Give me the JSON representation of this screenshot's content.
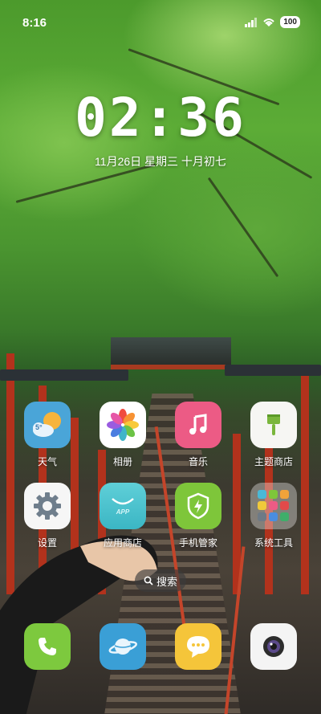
{
  "status_bar": {
    "time": "8:16",
    "battery": "100"
  },
  "lock": {
    "clock": "02:36",
    "date": "11月26日 星期三 十月初七"
  },
  "weather": {
    "temp": "5°"
  },
  "apps": [
    {
      "label": "天气",
      "icon": "weather-icon"
    },
    {
      "label": "相册",
      "icon": "photos-icon"
    },
    {
      "label": "音乐",
      "icon": "music-icon"
    },
    {
      "label": "主题商店",
      "icon": "theme-store-icon"
    },
    {
      "label": "设置",
      "icon": "settings-gear-icon"
    },
    {
      "label": "应用商店",
      "icon": "app-store-icon",
      "badge": "APP"
    },
    {
      "label": "手机管家",
      "icon": "phone-manager-shield-icon"
    },
    {
      "label": "系统工具",
      "icon": "system-tools-folder-icon"
    }
  ],
  "search": {
    "label": "搜索"
  },
  "dock": [
    {
      "icon": "phone-icon"
    },
    {
      "icon": "browser-icon"
    },
    {
      "icon": "messages-icon"
    },
    {
      "icon": "camera-icon"
    }
  ],
  "colors": {
    "weather_bg": "#4aa5d8",
    "music_bg": "#ec5b85",
    "manager_bg": "#7ec63a",
    "phone_bg": "#7dc93e",
    "browser_bg": "#3a9fd6",
    "messages_bg": "#f5c53a"
  }
}
